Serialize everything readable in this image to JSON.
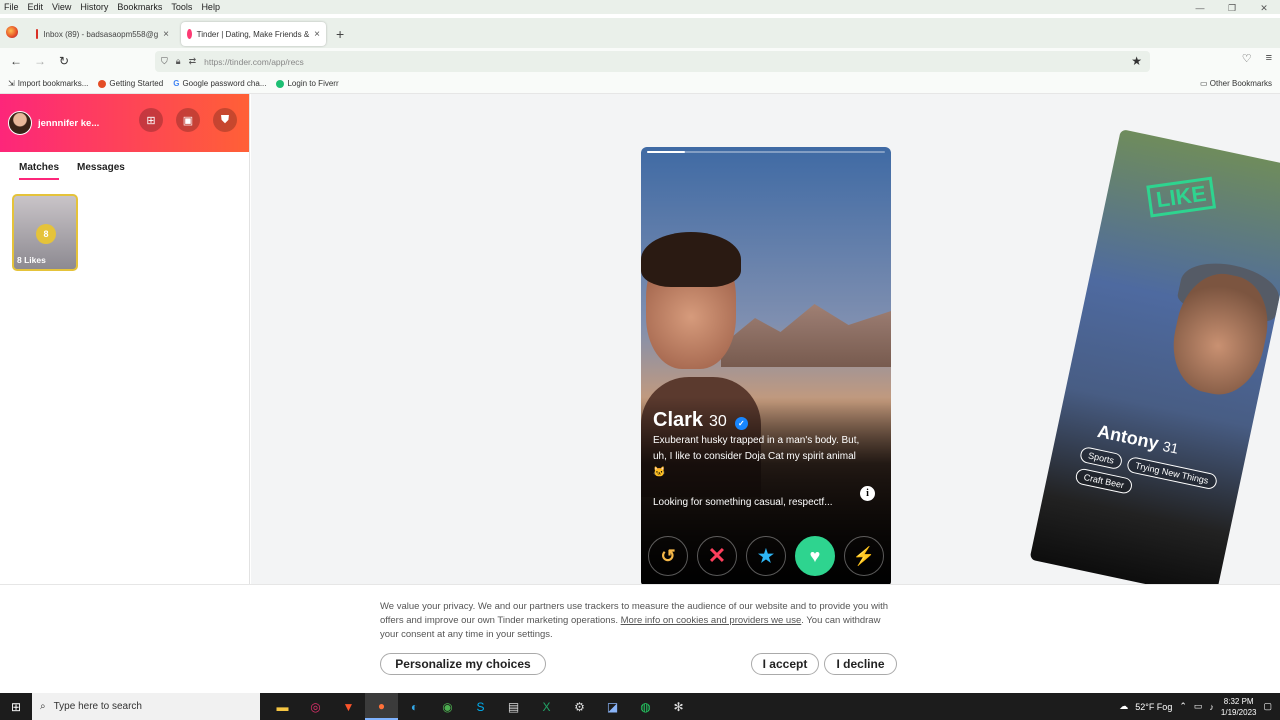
{
  "menu": [
    "File",
    "Edit",
    "View",
    "History",
    "Bookmarks",
    "Tools",
    "Help"
  ],
  "tabs": [
    {
      "label": "Inbox (89) - badsasaopm558@g",
      "close": "×"
    },
    {
      "label": "Tinder | Dating, Make Friends &",
      "close": "×"
    }
  ],
  "newtab": "+",
  "url": "https://tinder.com/app/recs",
  "bookmarks": [
    "Import bookmarks...",
    "Getting Started",
    "Google password cha...",
    "Login to Fiverr"
  ],
  "other_bookmarks": "Other Bookmarks",
  "sidebar": {
    "username": "jennnifer ke...",
    "tabs": [
      "Matches",
      "Messages"
    ],
    "likes_count": "8",
    "likes_label": "8 Likes"
  },
  "card": {
    "name": "Clark",
    "age": "30",
    "bio": "Exuberant husky trapped in a man's body. But, uh, I like to consider Doja Cat my spirit animal 🐱",
    "looking": "Looking for something casual, respectf...",
    "info": "i"
  },
  "next_card": {
    "stamp": "LIKE",
    "name": "Antony",
    "age": "31",
    "tags": [
      "Sports",
      "Trying New Things",
      "Craft Beer"
    ]
  },
  "cookie": {
    "text": "We value your privacy. We and our partners use trackers to measure the audience of our website and to provide you with offers and improve our own Tinder marketing operations.",
    "link": "More info on cookies and providers we use",
    "text2": ". You can withdraw your consent at any time in your settings.",
    "personalize": "Personalize my choices",
    "accept": "I accept",
    "decline": "I decline"
  },
  "taskbar": {
    "search_placeholder": "Type here to search",
    "weather": "52°F Fog",
    "time": "8:32 PM",
    "date": "1/19/2023"
  },
  "colors": {
    "brand_start": "#fd267a",
    "brand_end": "#ff6036",
    "like": "#2ed48f",
    "super": "#2db7f7",
    "boost": "#a54ff5",
    "nope": "#fd3f5c",
    "rewind": "#f5b748"
  }
}
